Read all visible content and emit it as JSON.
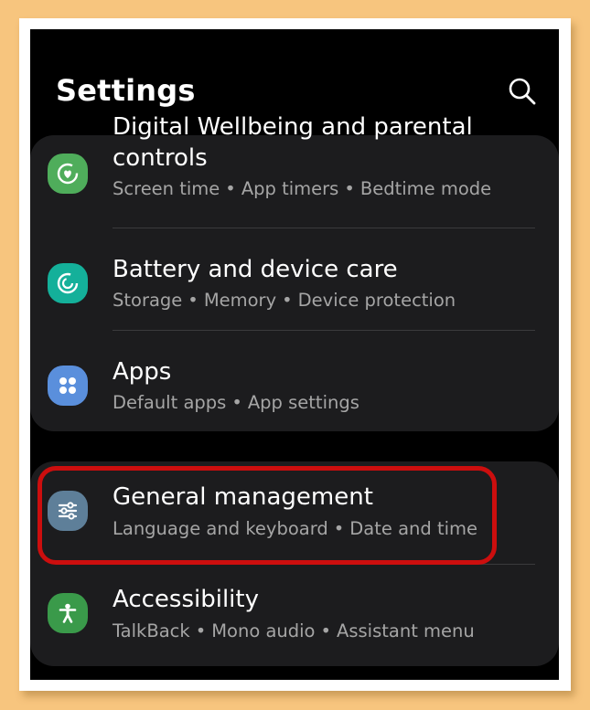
{
  "header": {
    "title": "Settings",
    "search_icon": "search-icon"
  },
  "colors": {
    "wellbeing_icon": "#4fad5b",
    "battery_icon": "#14b09a",
    "apps_icon": "#5a8fdc",
    "general_icon": "#5e7f99",
    "accessibility_icon": "#3a9a4a",
    "highlight": "#cc0e0e"
  },
  "items": [
    {
      "title_top": "Digital Wellbeing and parental",
      "title": "controls",
      "subs": [
        "Screen time",
        "App timers",
        "Bedtime mode"
      ],
      "icon": "wellbeing-icon"
    },
    {
      "title": "Battery and device care",
      "subs": [
        "Storage",
        "Memory",
        "Device protection"
      ],
      "icon": "battery-care-icon"
    },
    {
      "title": "Apps",
      "subs": [
        "Default apps",
        "App settings"
      ],
      "icon": "apps-icon"
    },
    {
      "title": "General management",
      "subs": [
        "Language and keyboard",
        "Date and time"
      ],
      "icon": "general-management-icon"
    },
    {
      "title": "Accessibility",
      "subs": [
        "TalkBack",
        "Mono audio",
        "Assistant menu"
      ],
      "icon": "accessibility-icon"
    }
  ],
  "separator": "•"
}
